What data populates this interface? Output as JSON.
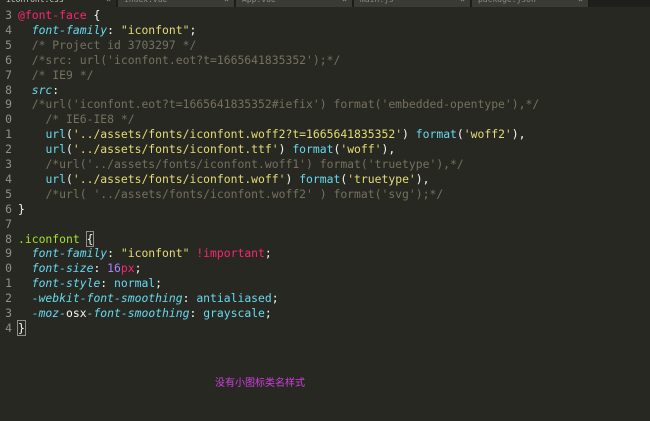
{
  "tabs": [
    {
      "label": "iconfont.css",
      "active": true
    },
    {
      "label": "index.vue"
    },
    {
      "label": "App.vue"
    },
    {
      "label": "main.js"
    },
    {
      "label": "package.json"
    }
  ],
  "lines": [
    {
      "no": "3",
      "html": "<span class=\"kw\">@font-face</span> <span class=\"pun\">{</span>"
    },
    {
      "no": "4",
      "html": "  <span class=\"prop\">font-family</span><span class=\"pun\">:</span> <span class=\"str\">\"iconfont\"</span><span class=\"pun\">;</span>"
    },
    {
      "no": "5",
      "html": "  <span class=\"com\">/* Project id 3703297 */</span>"
    },
    {
      "no": "6",
      "html": "  <span class=\"com\">/*src: url('iconfont.eot?t=1665641835352');*/</span>"
    },
    {
      "no": "7",
      "html": "  <span class=\"com\">/* IE9 */</span>"
    },
    {
      "no": "8",
      "html": "  <span class=\"prop\">src</span><span class=\"pun\">:</span>"
    },
    {
      "no": "9",
      "html": "  <span class=\"com\">/*url('iconfont.eot?t=1665641835352#iefix') format('embedded-opentype'),*/</span>"
    },
    {
      "no": "0",
      "html": "    <span class=\"com\">/* IE6-IE8 */</span>"
    },
    {
      "no": "1",
      "html": "    <span class=\"fn\">url</span><span class=\"pun\">(</span><span class=\"str\">'../assets/fonts/iconfont.woff2?t=1665641835352'</span><span class=\"pun\">)</span> <span class=\"fn\">format</span><span class=\"pun\">(</span><span class=\"str\">'woff2'</span><span class=\"pun\">),</span>"
    },
    {
      "no": "2",
      "html": "    <span class=\"fn\">url</span><span class=\"pun\">(</span><span class=\"str\">'../assets/fonts/iconfont.ttf'</span><span class=\"pun\">)</span> <span class=\"fn\">format</span><span class=\"pun\">(</span><span class=\"str\">'woff'</span><span class=\"pun\">),</span>"
    },
    {
      "no": "3",
      "html": "    <span class=\"com\">/*url('../assets/fonts/iconfont.woff1') format('truetype'),*/</span>"
    },
    {
      "no": "4",
      "html": "    <span class=\"fn\">url</span><span class=\"pun\">(</span><span class=\"str\">'../assets/fonts/iconfont.woff'</span><span class=\"pun\">)</span> <span class=\"fn\">format</span><span class=\"pun\">(</span><span class=\"str\">'truetype'</span><span class=\"pun\">),</span>"
    },
    {
      "no": "5",
      "html": "    <span class=\"com\">/*url( '../assets/fonts/iconfont.woff2' ) format('svg');*/</span>"
    },
    {
      "no": "6",
      "html": "<span class=\"pun\">}</span>"
    },
    {
      "no": "7",
      "html": ""
    },
    {
      "no": "8",
      "html": "<span class=\"cls\">.iconfont</span> <span class=\"pun cursor-box\">{</span>"
    },
    {
      "no": "9",
      "html": "  <span class=\"prop\">font-family</span><span class=\"pun\">:</span> <span class=\"str\">\"iconfont\"</span> <span class=\"imp\">!important</span><span class=\"pun\">;</span>"
    },
    {
      "no": "0",
      "html": "  <span class=\"prop\">font-size</span><span class=\"pun\">:</span> <span class=\"num\">16</span><span class=\"kw\">px</span><span class=\"pun\">;</span>"
    },
    {
      "no": "1",
      "html": "  <span class=\"prop\">font-style</span><span class=\"pun\">:</span> <span class=\"fn\">normal</span><span class=\"pun\">;</span>"
    },
    {
      "no": "2",
      "html": "  <span class=\"prop\">-webkit-font-smoothing</span><span class=\"pun\">:</span> <span class=\"fn\">antialiased</span><span class=\"pun\">;</span>"
    },
    {
      "no": "3",
      "html": "  <span class=\"prop\">-moz-</span>osx<span class=\"prop\">-font-smoothing</span><span class=\"pun\">:</span> <span class=\"fn\">grayscale</span><span class=\"pun\">;</span>"
    },
    {
      "no": "4",
      "html": "<span class=\"pun cursor-box\">}</span>"
    }
  ],
  "annotation": "没有小图标类名样式",
  "colors": {
    "background": "#272822",
    "keyword": "#f92672",
    "property": "#66d9ef",
    "string": "#e6db74",
    "comment": "#75715e",
    "selector": "#a6e22e",
    "number": "#ae81ff",
    "annotation": "#d23ee0"
  }
}
